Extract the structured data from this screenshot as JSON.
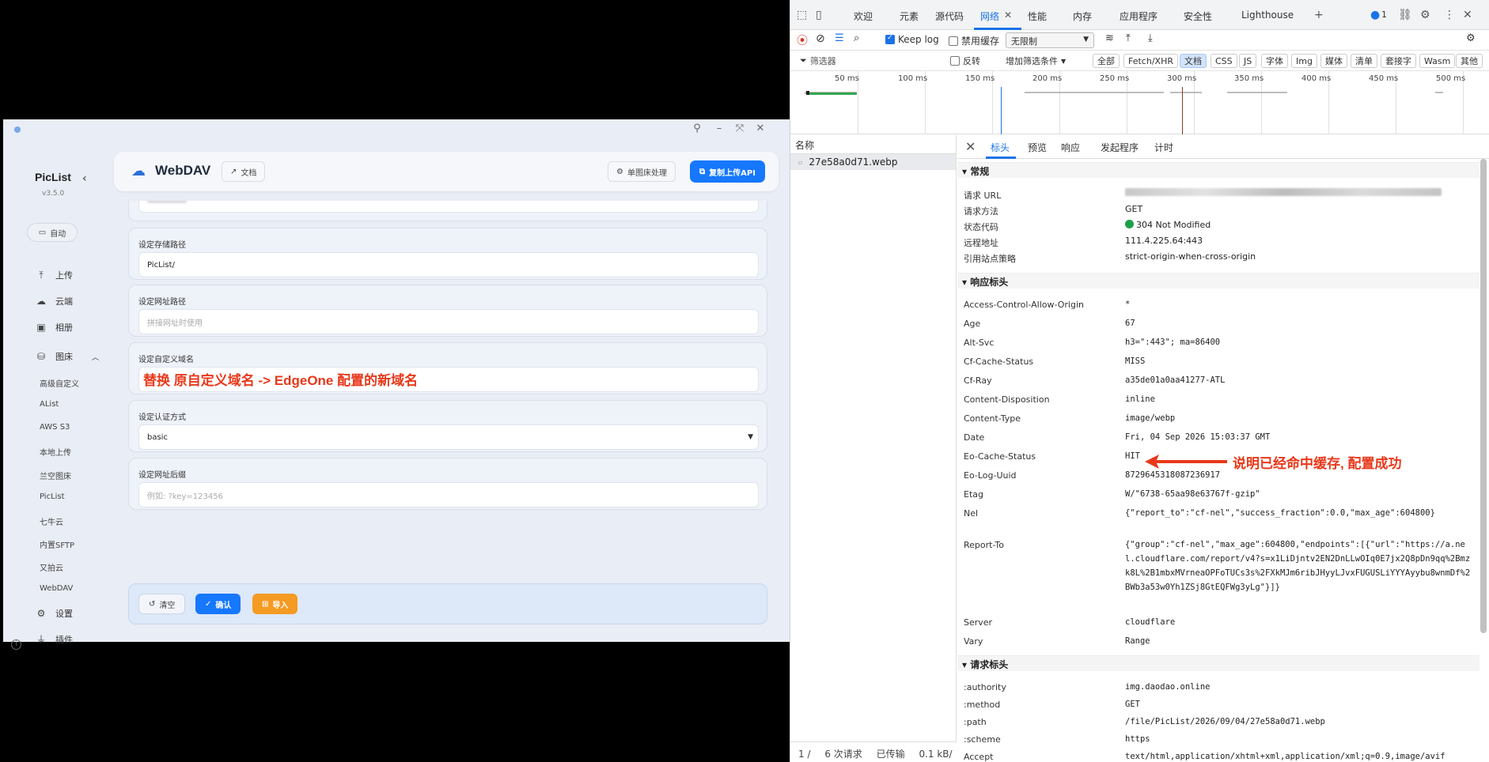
{
  "app": {
    "brand": "PicList",
    "version": "v3.5.0",
    "auto_label": "自动",
    "nav": [
      {
        "icon": "upload-icon",
        "label": "上传"
      },
      {
        "icon": "cloud-icon",
        "label": "云端"
      },
      {
        "icon": "album-icon",
        "label": "相册"
      },
      {
        "icon": "database-icon",
        "label": "图床"
      }
    ],
    "bed_items": [
      "高级自定义",
      "AList",
      "AWS S3",
      "本地上传",
      "兰空图床",
      "PicList",
      "七牛云",
      "内置SFTP",
      "又拍云",
      "WebDAV"
    ],
    "settings_label": "设置",
    "plugins_label": "插件",
    "header": {
      "title": "WebDAV",
      "doc_label": "文档",
      "single_label": "单图床处理",
      "copy_api_label": "复制上传API"
    },
    "form": {
      "path_label": "设定存储路径",
      "path_value": "PicList/",
      "web_path_label": "设定网址路径",
      "web_path_placeholder": "拼接网址时使用",
      "domain_label": "设定自定义域名",
      "domain_annotation": "替换 原自定义域名 -> EdgeOne 配置的新域名",
      "auth_label": "设定认证方式",
      "auth_value": "basic",
      "suffix_label": "设定网址后缀",
      "suffix_placeholder": "例如: ?key=123456"
    },
    "footer": {
      "clear": "清空",
      "confirm": "确认",
      "import": "导入"
    },
    "colors": {
      "primary": "#1677ff",
      "import": "#f59a23",
      "annotation": "#e8381a"
    }
  },
  "devtools": {
    "tabs": [
      "欢迎",
      "元素",
      "源代码",
      "网络",
      "性能",
      "内存",
      "应用程序",
      "安全性",
      "Lighthouse"
    ],
    "active_tab": "网络",
    "badge_count": "1",
    "keep_log": "Keep log",
    "disable_cache": "禁用缓存",
    "throttle": "无限制",
    "filter_placeholder": "筛选器",
    "invert": "反转",
    "more_filters": "增加筛选条件",
    "filter_types": [
      "全部",
      "Fetch/XHR",
      "文档",
      "CSS",
      "JS",
      "字体",
      "Img",
      "媒体",
      "清单",
      "套接字",
      "Wasm",
      "其他"
    ],
    "active_filter": "文档",
    "timeline_ticks": [
      "50 ms",
      "100 ms",
      "150 ms",
      "200 ms",
      "250 ms",
      "300 ms",
      "350 ms",
      "400 ms",
      "450 ms",
      "500 ms"
    ],
    "name_header": "名称",
    "request_name": "27e58a0d71.webp",
    "status_bar": {
      "page": "1 /",
      "requests": "6 次请求",
      "transferred": "已传输",
      "size": "0.1 kB/"
    },
    "detail_tabs": [
      "标头",
      "预览",
      "响应",
      "发起程序",
      "计时"
    ],
    "general_title": "常规",
    "general": [
      {
        "name": "请求 URL",
        "value": ""
      },
      {
        "name": "请求方法",
        "value": "GET"
      },
      {
        "name": "状态代码",
        "value": "304 Not Modified"
      },
      {
        "name": "远程地址",
        "value": "111.4.225.64:443"
      },
      {
        "name": "引用站点策略",
        "value": "strict-origin-when-cross-origin"
      }
    ],
    "response_title": "响应标头",
    "response": [
      {
        "name": "Access-Control-Allow-Origin",
        "value": "*"
      },
      {
        "name": "Age",
        "value": "67"
      },
      {
        "name": "Alt-Svc",
        "value": "h3=\":443\"; ma=86400"
      },
      {
        "name": "Cf-Cache-Status",
        "value": "MISS"
      },
      {
        "name": "Cf-Ray",
        "value": "a35de01a0aa41277-ATL"
      },
      {
        "name": "Content-Disposition",
        "value": "inline"
      },
      {
        "name": "Content-Type",
        "value": "image/webp"
      },
      {
        "name": "Date",
        "value": "Fri, 04 Sep 2026 15:03:37 GMT"
      },
      {
        "name": "Eo-Cache-Status",
        "value": "HIT"
      },
      {
        "name": "Eo-Log-Uuid",
        "value": "8729645318087236917"
      },
      {
        "name": "Etag",
        "value": "W/\"6738-65aa98e63767f-gzip\""
      },
      {
        "name": "Nel",
        "value": "{\"report_to\":\"cf-nel\",\"success_fraction\":0.0,\"max_age\":604800}"
      },
      {
        "name": "Report-To",
        "value": "{\"group\":\"cf-nel\",\"max_age\":604800,\"endpoints\":[{\"url\":\"https://a.nel.cloudflare.com/report/v4?s=x1LiDjntv2EN2DnLLwOIq0E7jx2Q8pDn9qq%2Bmzk8L%2B1mbxMVrneaOPFoTUCs3s%2FXkMJm6ribJHyyLJvxFUGUSLiYYYAyybu8wnmDf%2BWb3a53w0Yh1ZSj8GtEQFWg3yLg\"}]}"
      },
      {
        "name": "Server",
        "value": "cloudflare"
      },
      {
        "name": "Vary",
        "value": "Range"
      }
    ],
    "hit_annotation": "说明已经命中缓存, 配置成功",
    "request_title": "请求标头",
    "request": [
      {
        "name": ":authority",
        "value": "img.daodao.online"
      },
      {
        "name": ":method",
        "value": "GET"
      },
      {
        "name": ":path",
        "value": "/file/PicList/2026/09/04/27e58a0d71.webp"
      },
      {
        "name": ":scheme",
        "value": "https"
      },
      {
        "name": "Accept",
        "value": "text/html,application/xhtml+xml,application/xml;q=0.9,image/avif"
      }
    ],
    "colors": {
      "accent": "#1a73e8",
      "status_ok": "#1e9e4a"
    }
  }
}
